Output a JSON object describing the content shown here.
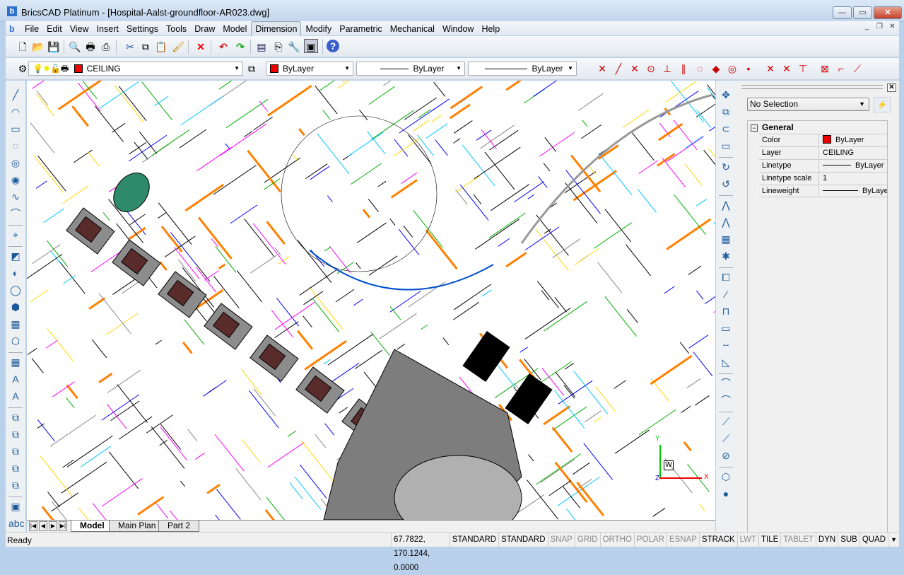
{
  "window": {
    "title": "BricsCAD Platinum - [Hospital-Aalst-groundfloor-AR023.dwg]",
    "logo": "b"
  },
  "menu": [
    "File",
    "Edit",
    "View",
    "Insert",
    "Settings",
    "Tools",
    "Draw",
    "Model",
    "Dimension",
    "Modify",
    "Parametric",
    "Mechanical",
    "Window",
    "Help"
  ],
  "menu_active": "Dimension",
  "layer_bar": {
    "layer": "CEILING",
    "color": "ByLayer",
    "linetype": "ByLayer",
    "lineweight": "ByLayer",
    "accent_color": "#ee0000"
  },
  "layout_tabs": [
    "Model",
    "Main Plan",
    "Part 2"
  ],
  "properties": {
    "selection": "No Selection",
    "section": "General",
    "rows": [
      {
        "key": "Color",
        "value": "ByLayer"
      },
      {
        "key": "Layer",
        "value": "CEILING"
      },
      {
        "key": "Linetype",
        "value": "ByLayer"
      },
      {
        "key": "Linetype scale",
        "value": "1"
      },
      {
        "key": "Lineweight",
        "value": "ByLayer"
      }
    ]
  },
  "status": {
    "ready": "Ready",
    "coords": "67.7822, 170.1244, 0.0000",
    "cells": [
      {
        "label": "STANDARD",
        "on": true
      },
      {
        "label": "STANDARD",
        "on": true
      },
      {
        "label": "SNAP",
        "on": false
      },
      {
        "label": "GRID",
        "on": false
      },
      {
        "label": "ORTHO",
        "on": false
      },
      {
        "label": "POLAR",
        "on": false
      },
      {
        "label": "ESNAP",
        "on": false
      },
      {
        "label": "STRACK",
        "on": true
      },
      {
        "label": "LWT",
        "on": false
      },
      {
        "label": "TILE",
        "on": true
      },
      {
        "label": "TABLET",
        "on": false
      },
      {
        "label": "DYN",
        "on": true
      },
      {
        "label": "SUB",
        "on": true
      },
      {
        "label": "QUAD",
        "on": true
      }
    ]
  },
  "ucs": {
    "w": "W",
    "x": "X",
    "y": "Y",
    "z": "Z"
  }
}
